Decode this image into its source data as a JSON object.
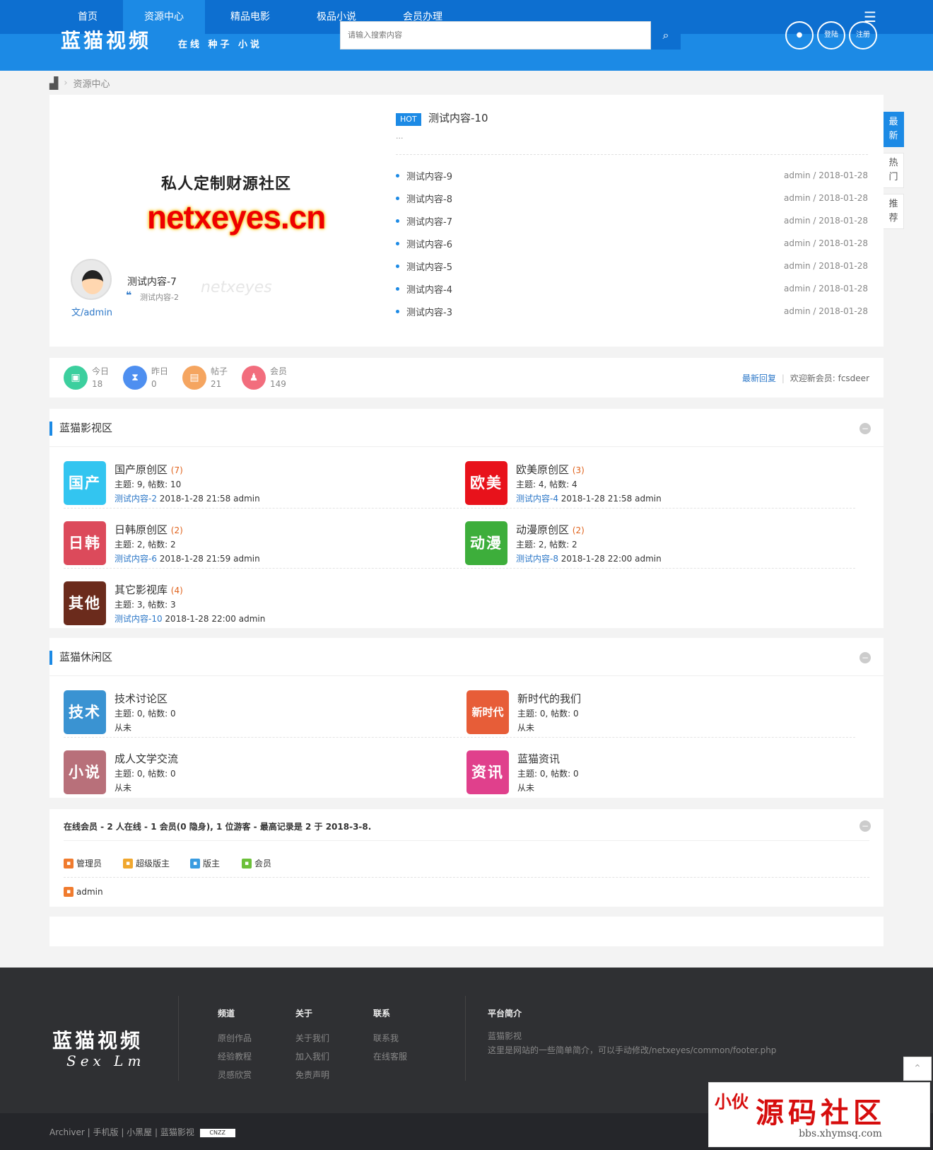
{
  "nav": {
    "items": [
      "首页",
      "资源中心",
      "精品电影",
      "极品小说",
      "会员办理"
    ],
    "active": 1
  },
  "brand": {
    "logo": "蓝猫视频",
    "logo_sub": "在线 种子 小说"
  },
  "search": {
    "placeholder": "请输入搜索内容"
  },
  "header_buttons": {
    "login": "登陆",
    "register": "注册"
  },
  "breadcrumb": {
    "current": "资源中心"
  },
  "side_tabs": [
    "最新",
    "热门",
    "推荐"
  ],
  "hero": {
    "image_line1": "私人定制财源社区",
    "image_line2": "netxeyes.cn",
    "watermark": "netxeyes",
    "quote_title": "测试内容-7",
    "quote_sub": "测试内容-2",
    "author": "文/admin"
  },
  "hot": {
    "badge": "HOT",
    "title": "测试内容-10",
    "excerpt": "...",
    "items": [
      {
        "title": "测试内容-9",
        "meta": "admin / 2018-01-28"
      },
      {
        "title": "测试内容-8",
        "meta": "admin / 2018-01-28"
      },
      {
        "title": "测试内容-7",
        "meta": "admin / 2018-01-28"
      },
      {
        "title": "测试内容-6",
        "meta": "admin / 2018-01-28"
      },
      {
        "title": "测试内容-5",
        "meta": "admin / 2018-01-28"
      },
      {
        "title": "测试内容-4",
        "meta": "admin / 2018-01-28"
      },
      {
        "title": "测试内容-3",
        "meta": "admin / 2018-01-28"
      }
    ]
  },
  "stats": {
    "today": {
      "label": "今日",
      "value": "18"
    },
    "yesterday": {
      "label": "昨日",
      "value": "0"
    },
    "posts": {
      "label": "帖子",
      "value": "21"
    },
    "members": {
      "label": "会员",
      "value": "149"
    },
    "latest_reply": "最新回复",
    "welcome": "欢迎新会员: fcsdeer"
  },
  "section1": {
    "title": "蓝猫影视区",
    "forums": [
      {
        "icon": "国产",
        "icon_color": "#33c5f0",
        "name": "国产原创区",
        "count": "(7)",
        "stats": "主题: 9, 帖数: 10",
        "last_link": "测试内容-2",
        "last_info": " 2018-1-28 21:58 admin"
      },
      {
        "icon": "欧美",
        "icon_color": "#e8121b",
        "name": "欧美原创区",
        "count": "(3)",
        "stats": "主题: 4, 帖数: 4",
        "last_link": "测试内容-4",
        "last_info": " 2018-1-28 21:58 admin"
      },
      {
        "icon": "日韩",
        "icon_color": "#dc4a5b",
        "name": "日韩原创区",
        "count": "(2)",
        "stats": "主题: 2, 帖数: 2",
        "last_link": "测试内容-6",
        "last_info": " 2018-1-28 21:59 admin"
      },
      {
        "icon": "动漫",
        "icon_color": "#3dae3b",
        "name": "动漫原创区",
        "count": "(2)",
        "stats": "主题: 2, 帖数: 2",
        "last_link": "测试内容-8",
        "last_info": " 2018-1-28 22:00 admin"
      },
      {
        "icon": "其他",
        "icon_color": "#6b2b1c",
        "name": "其它影视库",
        "count": "(4)",
        "stats": "主题: 3, 帖数: 3",
        "last_link": "测试内容-10",
        "last_info": " 2018-1-28 22:00 admin"
      }
    ]
  },
  "section2": {
    "title": "蓝猫休闲区",
    "forums": [
      {
        "icon": "技术",
        "icon_color": "#3a93d2",
        "name": "技术讨论区",
        "stats": "主题: 0, 帖数: 0",
        "last": "从未"
      },
      {
        "icon": "新时代",
        "icon_color": "#e75d38",
        "name": "新时代的我们",
        "stats": "主题: 0, 帖数: 0",
        "last": "从未"
      },
      {
        "icon": "小说",
        "icon_color": "#b8707a",
        "name": "成人文学交流",
        "stats": "主题: 0, 帖数: 0",
        "last": "从未"
      },
      {
        "icon": "资讯",
        "icon_color": "#e0408c",
        "name": "蓝猫资讯",
        "stats": "主题: 0, 帖数: 0",
        "last": "从未"
      }
    ]
  },
  "online": {
    "summary": "在线会员 - 2 人在线 - 1 会员(0 隐身), 1 位游客 - 最高记录是 2 于 2018-3-8.",
    "legend": [
      {
        "label": "管理员",
        "color": "#f07b2e"
      },
      {
        "label": "超级版主",
        "color": "#f0a72e"
      },
      {
        "label": "版主",
        "color": "#3a9ce0"
      },
      {
        "label": "会员",
        "color": "#6cc03a"
      }
    ],
    "user": "admin"
  },
  "footer": {
    "logo": "蓝猫视频",
    "logo_sub": "Sex Lm",
    "columns": [
      {
        "heading": "频道",
        "items": [
          "原创作品",
          "经验教程",
          "灵感欣赏"
        ]
      },
      {
        "heading": "关于",
        "items": [
          "关于我们",
          "加入我们",
          "免责声明"
        ]
      },
      {
        "heading": "联系",
        "items": [
          "联系我",
          "在线客服"
        ]
      }
    ],
    "intro_heading": "平台简介",
    "intro_name": "蓝猫影视",
    "intro_text": "这里是网站的一些简单简介，可以手动修改/netxeyes/common/footer.php",
    "bottom_links": "Archiver | 手机版 | 小黑屋 | 蓝猫影视",
    "cnzz": "CNZZ"
  },
  "site_watermark": {
    "badge": "小伙",
    "title": "源码社区",
    "url": "bbs.xhymsq.com"
  }
}
